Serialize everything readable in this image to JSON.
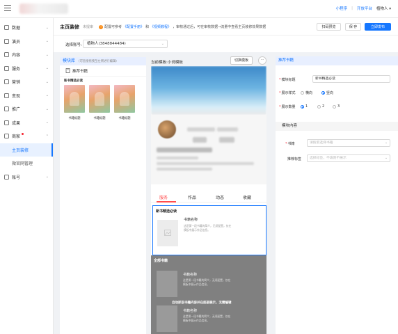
{
  "topbar": {
    "links": [
      "小程序",
      "开放平台"
    ],
    "separator": "|",
    "user": "植物人 ▾"
  },
  "sidebar": {
    "items": [
      {
        "label": "数据",
        "chev": "⌄"
      },
      {
        "label": "演员",
        "chev": "⌄"
      },
      {
        "label": "内容",
        "chev": "⌄"
      },
      {
        "label": "服务",
        "chev": "⌄"
      },
      {
        "label": "营销",
        "chev": "⌄"
      },
      {
        "label": "变现",
        "chev": "⌄"
      },
      {
        "label": "推广",
        "chev": "⌄"
      },
      {
        "label": "成果",
        "chev": "⌄"
      },
      {
        "label": "商家",
        "chev": "⌃"
      }
    ],
    "sub_items": [
      "主页装修",
      "微官网管理"
    ],
    "last_item": {
      "label": "账号",
      "chev": "⌄"
    }
  },
  "header": {
    "title": "主页装修",
    "status": "未提审",
    "tip_prefix": "配置可参考",
    "tip_link1": "《配置手册》",
    "tip_and": "和",
    "tip_link2": "《视频教程》",
    "tip_suffix": "，审核通过后，可在审核数据→流量中查看主页装修效果数据",
    "buttons": [
      "扫码预览",
      "保 存",
      "立即发布"
    ]
  },
  "account": {
    "label": "选择账号:",
    "value": "植物人(3848844484)"
  },
  "library": {
    "title": "模块库",
    "hint": "(可直接拖拽至左侧进行编辑)",
    "item": "推荐书籍",
    "card_title": "新书精选必读",
    "covers": [
      "书籍标题",
      "书籍标题",
      "书籍标题"
    ]
  },
  "preview": {
    "title": "当前模板:小说模板",
    "switch_label": "切换模板",
    "more": "···",
    "tabs": [
      "服务",
      "作品",
      "动态",
      "收藏"
    ],
    "section1": {
      "title": "新书精选必读",
      "book_name": "书籍名称",
      "book_desc": "这是第一段书籍的简介，无须配置，仅在模板中展示作品信息。"
    },
    "section2": {
      "title": "全部书籍",
      "book_name": "书籍名称",
      "book_desc": "这是第一段书籍的简介，无须配置，仅在模板中展示作品信息。",
      "overlay": "自动抓取书籍内容并在底部展示，无需编辑"
    }
  },
  "props": {
    "title": "推荐书籍",
    "fields": {
      "block_title": {
        "label": "模块标题",
        "value": "新书精选必读"
      },
      "display_style": {
        "label": "展示样式",
        "options": [
          "横向",
          "竖向"
        ],
        "selected": "竖向"
      },
      "display_count": {
        "label": "展示数量",
        "options": [
          "1",
          "2",
          "3"
        ],
        "selected": "1"
      }
    },
    "content_title": "模块内容",
    "book": {
      "label": "书籍",
      "placeholder": "请搜索选择书籍"
    },
    "tags": {
      "label": "推荐标签",
      "placeholder": "选择标签，不填则不展示"
    }
  },
  "colors": {
    "accent": "#1677ff",
    "danger": "#ff4d4f"
  }
}
